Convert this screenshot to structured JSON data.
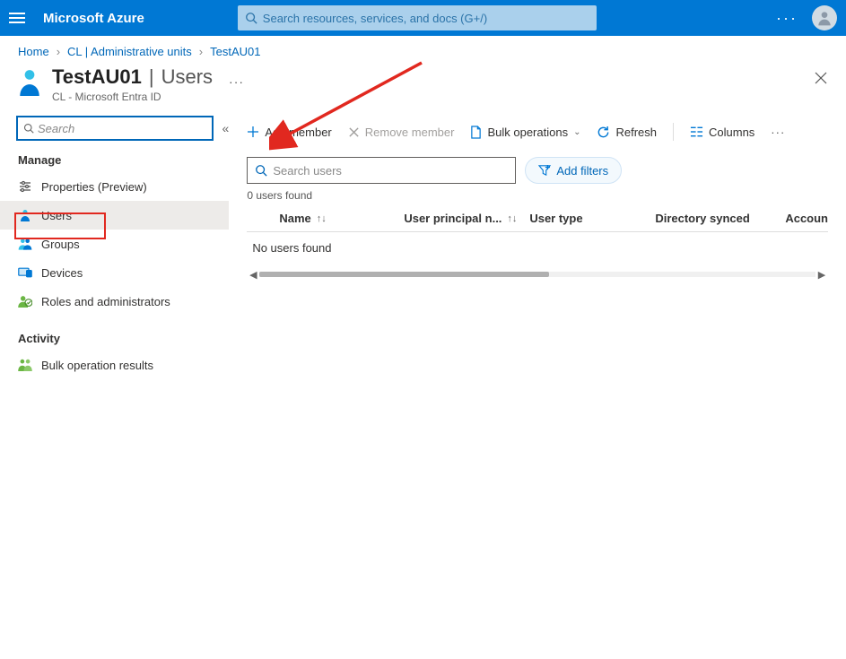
{
  "topbar": {
    "brand": "Microsoft Azure",
    "search_placeholder": "Search resources, services, and docs (G+/)"
  },
  "breadcrumb": {
    "home": "Home",
    "level1": "CL | Administrative units",
    "level2": "TestAU01"
  },
  "header": {
    "title_main": "TestAU01",
    "title_suffix": "Users",
    "subtitle": "CL - Microsoft Entra ID"
  },
  "sidebar": {
    "search_placeholder": "Search",
    "sections": {
      "manage": "Manage",
      "activity": "Activity"
    },
    "items": [
      {
        "id": "properties",
        "label": "Properties (Preview)"
      },
      {
        "id": "users",
        "label": "Users"
      },
      {
        "id": "groups",
        "label": "Groups"
      },
      {
        "id": "devices",
        "label": "Devices"
      },
      {
        "id": "roles",
        "label": "Roles and administrators"
      }
    ],
    "activity_items": [
      {
        "id": "bulk",
        "label": "Bulk operation results"
      }
    ]
  },
  "toolbar": {
    "add_member": "Add member",
    "remove_member": "Remove member",
    "bulk_ops": "Bulk operations",
    "refresh": "Refresh",
    "columns": "Columns"
  },
  "main": {
    "search_users_placeholder": "Search users",
    "add_filters": "Add filters",
    "count": "0 users found",
    "columns": {
      "name": "Name",
      "upn": "User principal n...",
      "usertype": "User type",
      "dirsynced": "Directory synced",
      "account": "Accoun"
    },
    "empty": "No users found"
  }
}
